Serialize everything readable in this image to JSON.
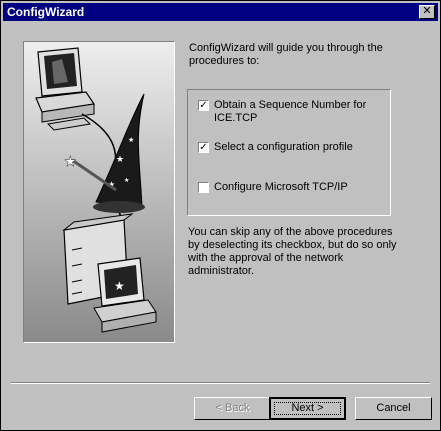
{
  "window": {
    "title": "ConfigWizard",
    "close_glyph": "✕"
  },
  "intro_text": "ConfigWizard will guide you through the procedures to:",
  "options": [
    {
      "label": "Obtain a Sequence Number for ICE.TCP",
      "checked": true
    },
    {
      "label": "Select a configuration profile",
      "checked": true
    },
    {
      "label": "Configure Microsoft TCP/IP",
      "checked": false
    }
  ],
  "check_glyph": "✓",
  "note_text": "You can skip any of the above procedures by deselecting its checkbox, but do so only with the approval of the network administrator.",
  "buttons": {
    "back": "< Back",
    "next": "Next >",
    "cancel": "Cancel"
  },
  "illustration": {
    "icons": [
      "computer-icon",
      "wizard-hat-icon",
      "magic-wand-icon",
      "server-computer-icon"
    ]
  },
  "colors": {
    "title_bar": "#000080",
    "face": "#c0c0c0"
  }
}
